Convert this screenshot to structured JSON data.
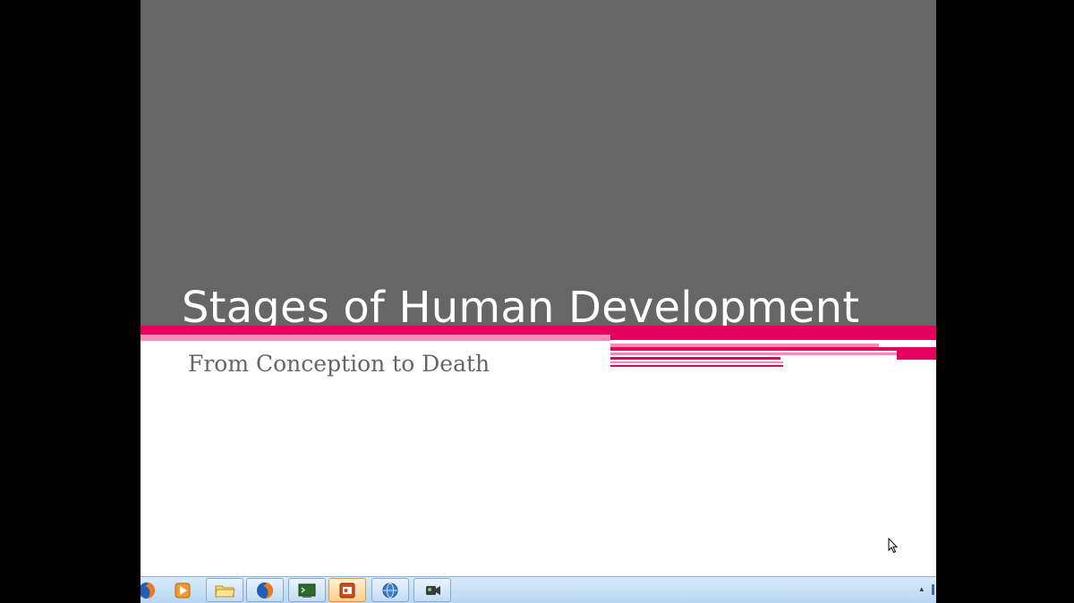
{
  "slide": {
    "title": "Stages of Human Development",
    "subtitle": "From Conception to Death"
  },
  "colors": {
    "outer_background": "#000000",
    "slide_top": "#666666",
    "slide_bottom": "#ffffff",
    "accent_pink": "#e5005f",
    "accent_pink_light": "#f48cb5",
    "title_text": "#ffffff",
    "subtitle_text": "#666666",
    "taskbar": "#c9e0f6"
  },
  "taskbar": {
    "items": [
      {
        "icon": "firefox-icon"
      },
      {
        "icon": "media-player-icon"
      },
      {
        "icon": "folder-icon"
      },
      {
        "icon": "firefox-icon"
      },
      {
        "icon": "terminal-icon"
      },
      {
        "icon": "powerpoint-icon",
        "active": true
      },
      {
        "icon": "network-globe-icon"
      },
      {
        "icon": "camcorder-icon"
      }
    ],
    "tray_arrow": "▴"
  }
}
